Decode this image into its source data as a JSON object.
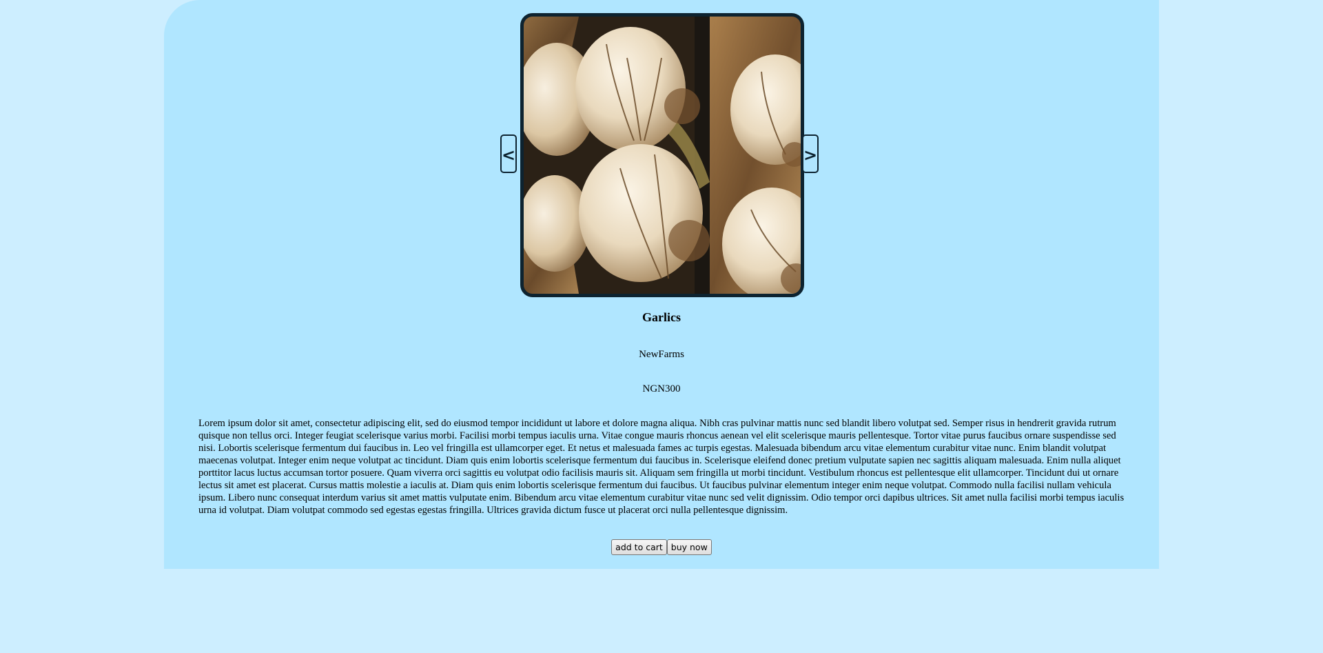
{
  "product": {
    "image_alt": "Garlics",
    "prev_label": "<",
    "next_label": ">",
    "title": "Garlics",
    "vendor": "NewFarms",
    "price": "NGN300",
    "description": "Lorem ipsum dolor sit amet, consectetur adipiscing elit, sed do eiusmod tempor incididunt ut labore et dolore magna aliqua. Nibh cras pulvinar mattis nunc sed blandit libero volutpat sed. Semper risus in hendrerit gravida rutrum quisque non tellus orci. Integer feugiat scelerisque varius morbi. Facilisi morbi tempus iaculis urna. Vitae congue mauris rhoncus aenean vel elit scelerisque mauris pellentesque. Tortor vitae purus faucibus ornare suspendisse sed nisi. Lobortis scelerisque fermentum dui faucibus in. Leo vel fringilla est ullamcorper eget. Et netus et malesuada fames ac turpis egestas. Malesuada bibendum arcu vitae elementum curabitur vitae nunc. Enim blandit volutpat maecenas volutpat. Integer enim neque volutpat ac tincidunt. Diam quis enim lobortis scelerisque fermentum dui faucibus in. Scelerisque eleifend donec pretium vulputate sapien nec sagittis aliquam malesuada. Enim nulla aliquet porttitor lacus luctus accumsan tortor posuere. Quam viverra orci sagittis eu volutpat odio facilisis mauris sit. Aliquam sem fringilla ut morbi tincidunt. Vestibulum rhoncus est pellentesque elit ullamcorper. Tincidunt dui ut ornare lectus sit amet est placerat. Cursus mattis molestie a iaculis at. Diam quis enim lobortis scelerisque fermentum dui faucibus. Ut faucibus pulvinar elementum integer enim neque volutpat. Commodo nulla facilisi nullam vehicula ipsum. Libero nunc consequat interdum varius sit amet mattis vulputate enim. Bibendum arcu vitae elementum curabitur vitae nunc sed velit dignissim. Odio tempor orci dapibus ultrices. Sit amet nulla facilisi morbi tempus iaculis urna id volutpat. Diam volutpat commodo sed egestas egestas fringilla. Ultrices gravida dictum fusce ut placerat orci nulla pellentesque dignissim."
  },
  "actions": {
    "add_to_cart_label": "add to cart",
    "buy_now_label": "buy now"
  },
  "colors": {
    "page_background": "#cdeeff",
    "panel_background": "#b0e6ff",
    "frame_border": "#0d2330"
  }
}
